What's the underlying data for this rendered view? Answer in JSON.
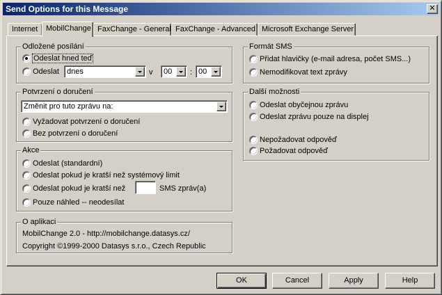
{
  "window": {
    "title": "Send Options for this Message",
    "close_symbol": "✕"
  },
  "tabs": [
    {
      "label": "Internet"
    },
    {
      "label": "MobilChange",
      "active": true
    },
    {
      "label": "FaxChange - General"
    },
    {
      "label": "FaxChange - Advanced"
    },
    {
      "label": "Microsoft Exchange Server"
    }
  ],
  "delayed_send": {
    "title": "Odložené posílání",
    "option_now": "Odeslat hned teď",
    "option_at": "Odeslat",
    "day_value": "dnes",
    "at_label": "v",
    "hour_value": "00",
    "time_sep": ":",
    "minute_value": "00",
    "selected": "now"
  },
  "delivery_receipt": {
    "title": "Potvrzení o doručení",
    "combo_value": "Změnit pro tuto zprávu na:",
    "option_require": "Vyžadovat potvrzení o doručení",
    "option_none": "Bez potvrzení o doručení"
  },
  "action": {
    "title": "Akce",
    "option_standard": "Odeslat (standardní)",
    "option_shorter_limit": "Odeslat pokud je kratší než systémový limit",
    "option_shorter_than": "Odeslat pokud je kratší než",
    "sms_count_value": "",
    "sms_suffix": "SMS zpráv(a)",
    "option_preview": "Pouze náhled -- neodesílat"
  },
  "about": {
    "title": "O aplikaci",
    "line1": "MobilChange 2.0  -  http://mobilchange.datasys.cz/",
    "line2": "Copyright ©1999-2000 Datasys s.r.o., Czech Republic"
  },
  "sms_format": {
    "title": "Formát SMS",
    "option_add_headers": "Přidat hlavičky (e-mail adresa, počet SMS...)",
    "option_no_modify": "Nemodifikovat text zprávy"
  },
  "more_options": {
    "title": "Další možnosti",
    "option_normal": "Odeslat obyčejnou zprávu",
    "option_display_only": "Odeslat zprávu pouze na displej",
    "option_no_reply": "Nepožadovat odpověď",
    "option_request_reply": "Požadovat odpověď"
  },
  "buttons": {
    "ok": "OK",
    "cancel": "Cancel",
    "apply": "Apply",
    "help": "Help"
  },
  "colors": {
    "title_start": "#0a246a",
    "title_end": "#a6caf0",
    "face": "#d4d0c8"
  }
}
